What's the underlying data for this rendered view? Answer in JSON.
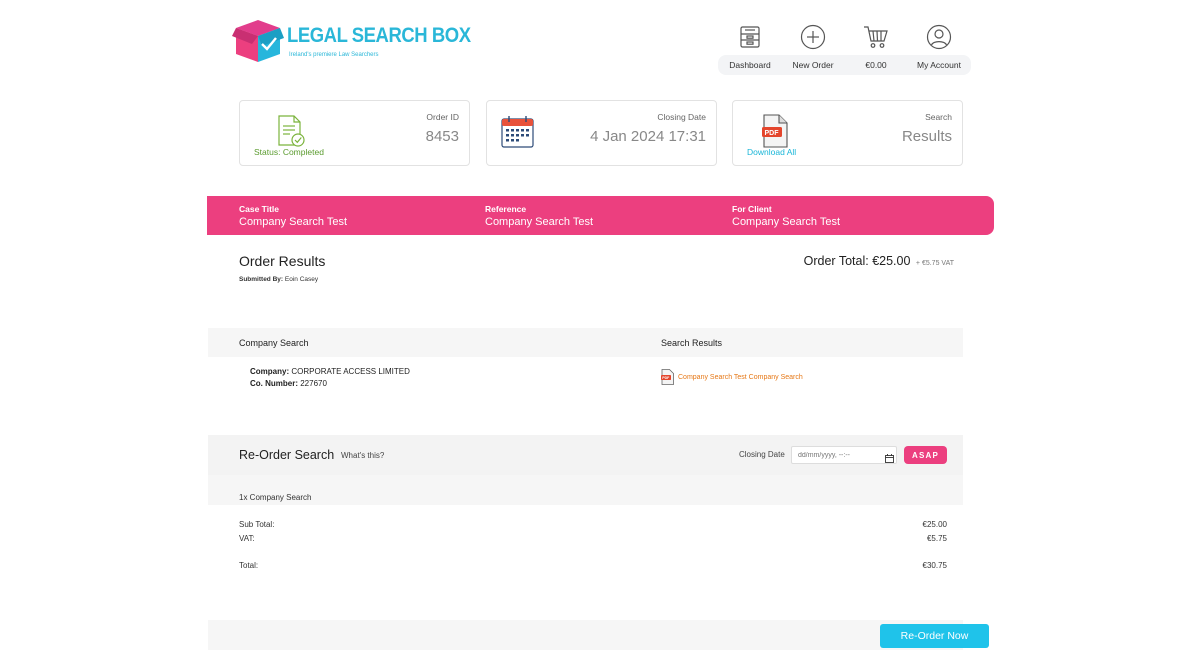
{
  "brand": {
    "name": "LEGAL SEARCH BOX",
    "tagline": "Ireland's premiere Law Searchers",
    "colors": {
      "cyan": "#2ab7d8",
      "pink": "#ec3f7f",
      "green": "#5a9b2e",
      "orange": "#e67817"
    }
  },
  "nav": {
    "items": [
      {
        "label": "Dashboard",
        "icon": "inbox-tray-icon"
      },
      {
        "label": "New Order",
        "icon": "plus-circle-icon"
      },
      {
        "label": "€0.00",
        "icon": "shopping-cart-icon"
      },
      {
        "label": "My Account",
        "icon": "user-circle-icon"
      }
    ]
  },
  "cards": {
    "order": {
      "label": "Order ID",
      "value": "8453",
      "status": "Status: Completed",
      "icon": "document-check-icon"
    },
    "closing": {
      "label": "Closing Date",
      "value": "4 Jan 2024 17:31",
      "icon": "calendar-icon"
    },
    "search": {
      "label": "Search",
      "value": "Results",
      "link": "Download All",
      "icon": "pdf-file-icon"
    }
  },
  "band": {
    "case_title": {
      "label": "Case Title",
      "value": "Company Search Test"
    },
    "reference": {
      "label": "Reference",
      "value": "Company Search Test"
    },
    "for_client": {
      "label": "For Client",
      "value": "Company Search Test"
    }
  },
  "results": {
    "title": "Order Results",
    "submitted_label": "Submitted By:",
    "submitted_by": "Eoin Casey",
    "total_label": "Order Total:",
    "total_value": "€25.00",
    "vat_note": "+ €5.75 VAT"
  },
  "table": {
    "headers": [
      "Company Search",
      "Search Results"
    ],
    "company_label": "Company:",
    "company_value": "CORPORATE ACCESS LIMITED",
    "number_label": "Co. Number:",
    "number_value": "227670",
    "result_link": "Company Search Test Company Search"
  },
  "reorder": {
    "title": "Re-Order Search",
    "help": "What's this?",
    "closing_label": "Closing Date",
    "date_placeholder": "dd/mm/yyyy, --:--",
    "asap": "ASAP",
    "line_item": "1x Company Search",
    "subtotal_label": "Sub Total:",
    "subtotal_value": "€25.00",
    "vat_label": "VAT:",
    "vat_value": "€5.75",
    "total_label": "Total:",
    "total_value": "€30.75",
    "button": "Re-Order Now"
  }
}
